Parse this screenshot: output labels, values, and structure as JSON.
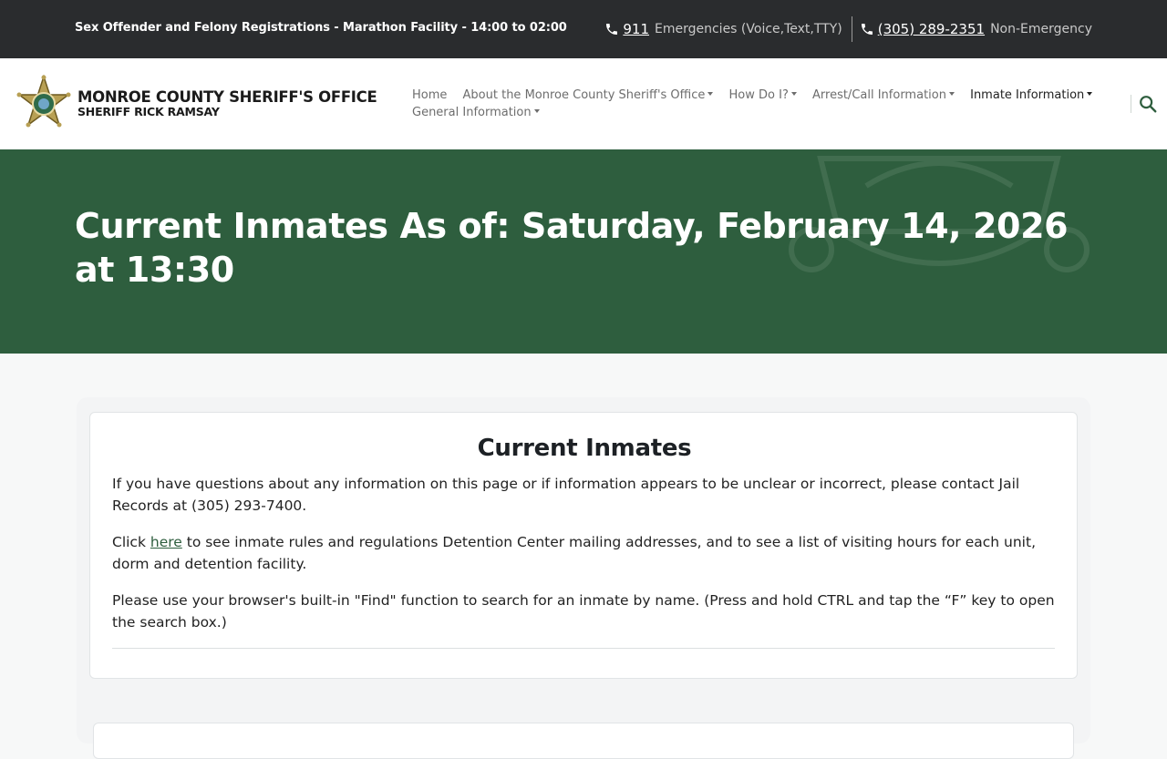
{
  "topbar": {
    "announcement": "Sex Offender and Felony Registrations - Marathon Facility - 14:00 to 02:00",
    "emergency_number": "911",
    "emergency_desc": "Emergencies (Voice,Text,TTY)",
    "nonemergency_number": "(305) 289-2351",
    "nonemergency_desc": "Non-Emergency"
  },
  "header": {
    "org_name": "MONROE COUNTY SHERIFF'S OFFICE",
    "sheriff_name": "SHERIFF RICK RAMSAY",
    "nav": [
      {
        "label": "Home"
      },
      {
        "label": "About the Monroe County Sheriff's Office"
      },
      {
        "label": "How Do I?"
      },
      {
        "label": "Arrest/Call Information"
      },
      {
        "label": "Inmate Information"
      },
      {
        "label": "General Information"
      }
    ]
  },
  "hero": {
    "title": "Current Inmates As of: Saturday, February 14, 2026 at 13:30"
  },
  "card": {
    "heading": "Current Inmates",
    "para1": "If you have questions about any information on this page or if information appears to be unclear or incorrect, please contact Jail Records at (305) 293-7400.",
    "para2_before": "Click ",
    "para2_link": "here",
    "para2_after": " to see inmate rules and regulations Detention Center mailing addresses, and to see a list of visiting hours for each unit, dorm and detention facility.",
    "para3": "Please use your browser's built-in \"Find\" function to search for an inmate by name. (Press and hold CTRL and tap the “F” key to open the search box.)"
  },
  "colors": {
    "topbar_bg": "#2a2c2e",
    "brand_green": "#2e5e3e",
    "page_bg": "#f7f8f8"
  },
  "icons": {
    "phone": "phone-icon",
    "search": "search-icon",
    "logo": "sheriff-star-badge-icon",
    "caret": "caret-down-icon"
  }
}
